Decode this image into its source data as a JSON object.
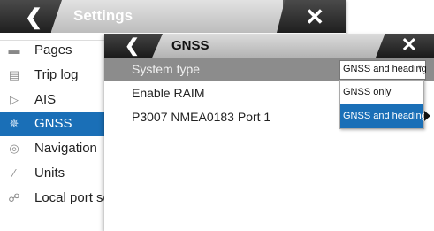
{
  "settings": {
    "title": "Settings",
    "items": [
      {
        "label": "Pages",
        "icon": "pages-icon",
        "selected": false
      },
      {
        "label": "Trip log",
        "icon": "trip-log-icon",
        "selected": false
      },
      {
        "label": "AIS",
        "icon": "ais-icon",
        "selected": false
      },
      {
        "label": "GNSS",
        "icon": "gnss-icon",
        "selected": true
      },
      {
        "label": "Navigation",
        "icon": "navigation-icon",
        "selected": false
      },
      {
        "label": "Units",
        "icon": "units-icon",
        "selected": false
      },
      {
        "label": "Local port setup",
        "icon": "local-port-icon",
        "selected": false
      }
    ]
  },
  "gnss": {
    "title": "GNSS",
    "rows": [
      {
        "label": "System type",
        "value": "GNSS and heading",
        "highlighted": true
      },
      {
        "label": "Enable RAIM"
      },
      {
        "label": "P3007 NMEA0183 Port 1"
      }
    ],
    "dropdown": {
      "options": [
        "GNSS only",
        "GNSS and heading"
      ],
      "selected": "GNSS and heading"
    }
  },
  "colors": {
    "accent": "#1a6fb7",
    "title_dark": "#2a2a2a",
    "highlight_row": "#8c8c8c"
  }
}
